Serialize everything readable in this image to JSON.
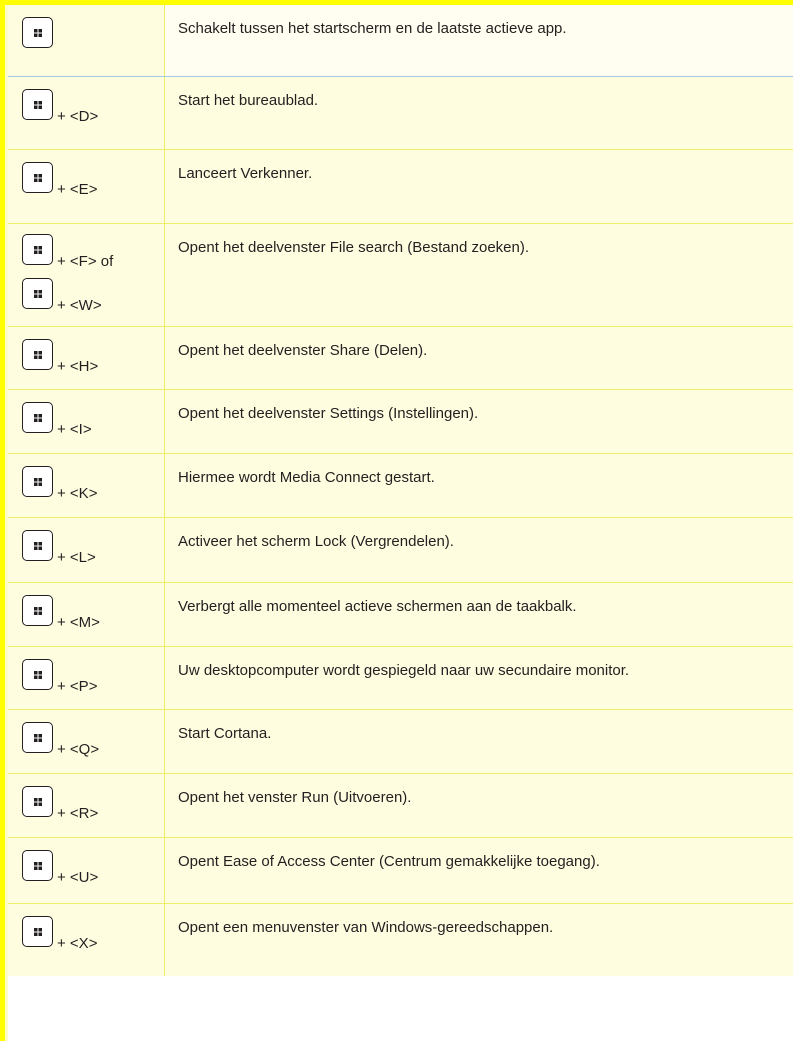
{
  "rows": [
    {
      "keys": [
        ""
      ],
      "description": "Schakelt tussen het startscherm en de laatste actieve app."
    },
    {
      "keys": [
        "+ <D>"
      ],
      "description": "Start het bureaublad."
    },
    {
      "keys": [
        "+ <E>"
      ],
      "description": "Lanceert Verkenner."
    },
    {
      "keys": [
        "+ <F>  of",
        "+ <W>"
      ],
      "description": "Opent het deelvenster File search (Bestand zoeken)."
    },
    {
      "keys": [
        "+ <H>"
      ],
      "description": "Opent het deelvenster Share (Delen)."
    },
    {
      "keys": [
        "+ <I>"
      ],
      "description": "Opent het deelvenster Settings (Instellingen)."
    },
    {
      "keys": [
        "+ <K>"
      ],
      "description": "Hiermee wordt Media Connect gestart."
    },
    {
      "keys": [
        "+ <L>"
      ],
      "description": "Activeer het scherm Lock (Vergrendelen)."
    },
    {
      "keys": [
        "+ <M>"
      ],
      "description": "Verbergt alle momenteel actieve schermen aan de taakbalk."
    },
    {
      "keys": [
        "+ <P>"
      ],
      "description": "Uw desktopcomputer wordt gespiegeld naar uw secundaire monitor."
    },
    {
      "keys": [
        "+ <Q>"
      ],
      "description": "Start Cortana."
    },
    {
      "keys": [
        "+ <R>"
      ],
      "description": "Opent het venster Run (Uitvoeren)."
    },
    {
      "keys": [
        "+ <U>"
      ],
      "description": "Opent Ease of Access Center (Centrum gemakkelijke toegang)."
    },
    {
      "keys": [
        "+ <X>"
      ],
      "description": "Opent een menuvenster van Windows-gereedschappen."
    }
  ],
  "icons": {
    "key": "windows-logo-icon"
  },
  "colors": {
    "accent": "#ffff00",
    "row_fill": "#fffde0",
    "grid": "#eeee6a",
    "text": "#231f20"
  }
}
